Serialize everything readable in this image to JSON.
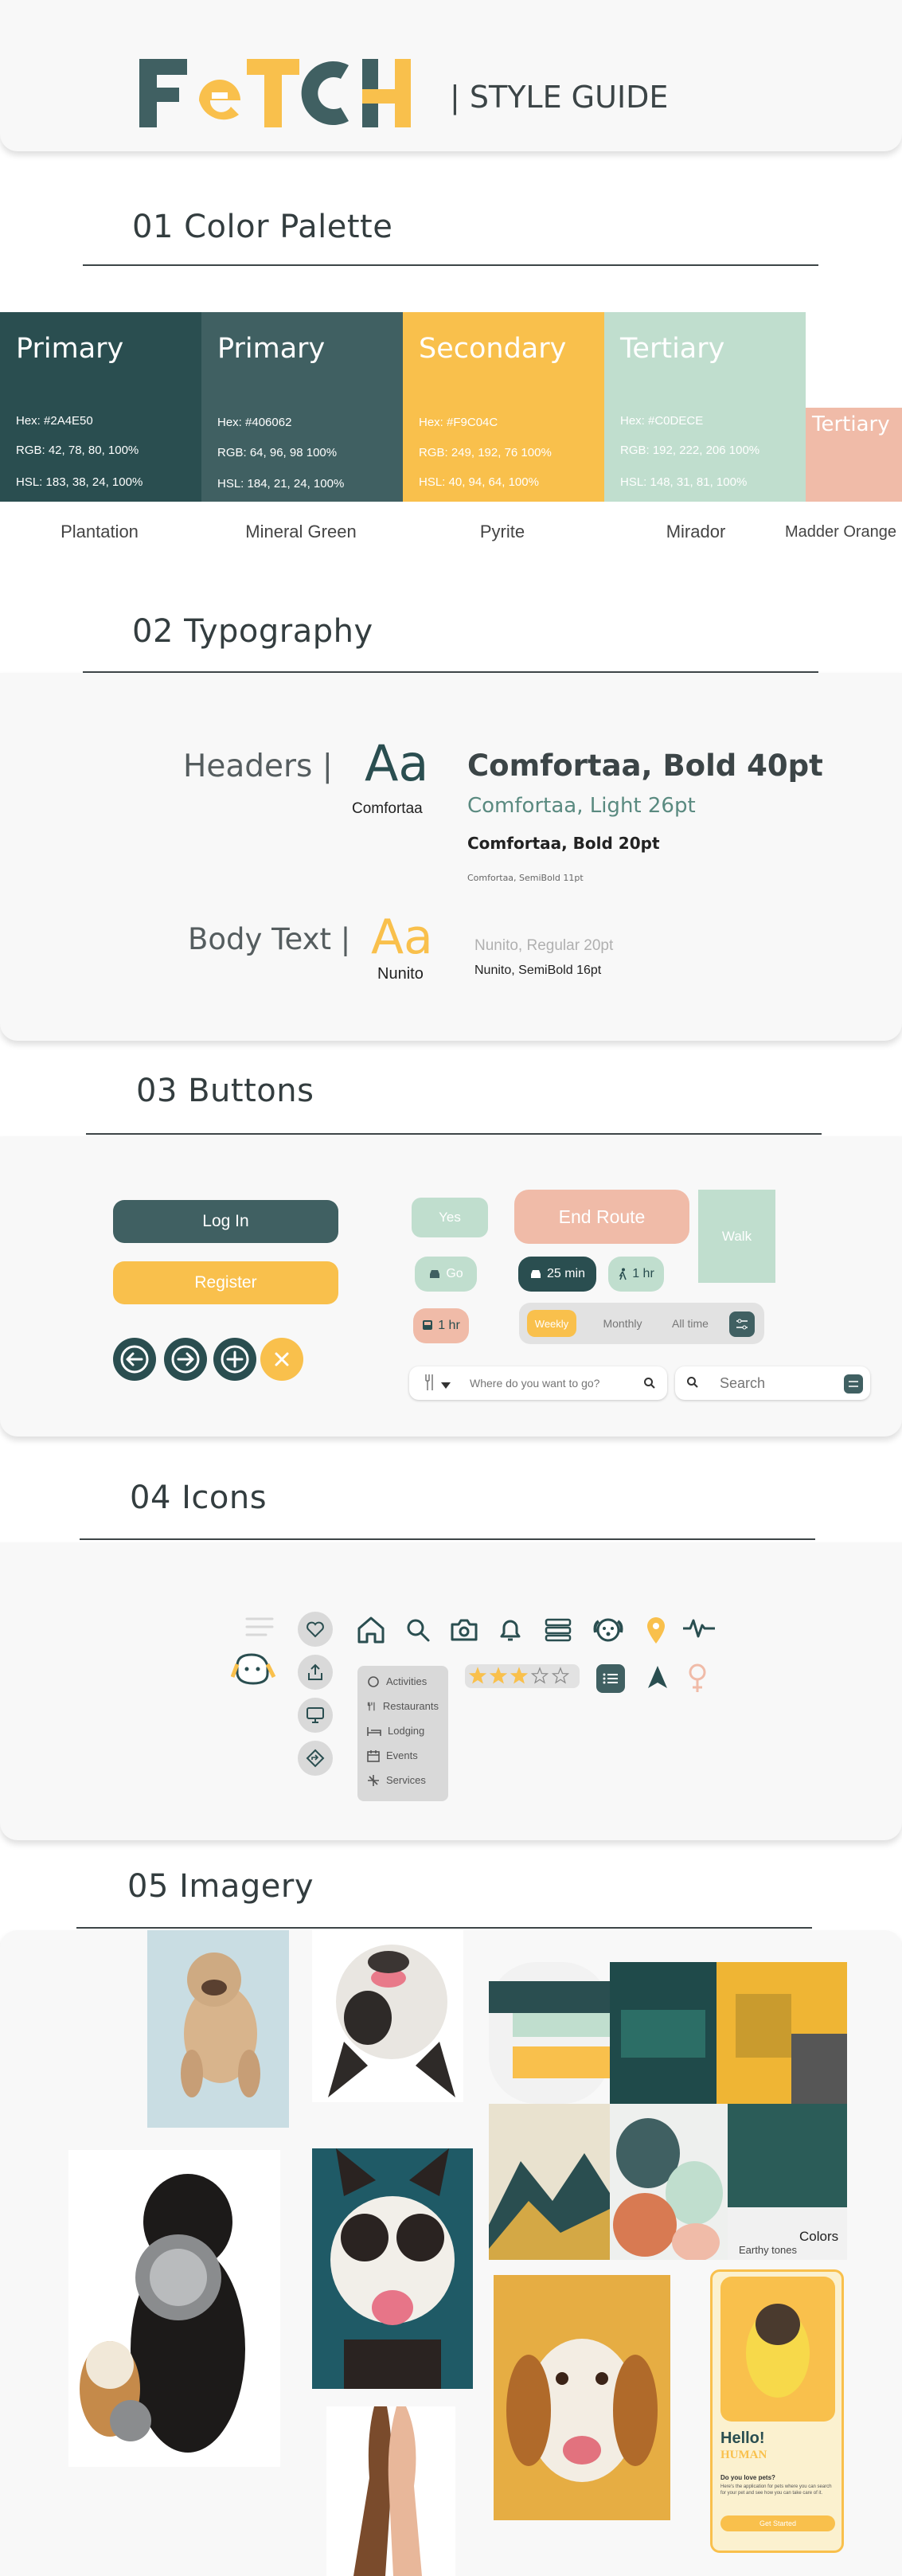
{
  "header": {
    "logo_text": "FETCH",
    "subtitle": "| STYLE GUIDE"
  },
  "sections": {
    "color": "01 Color Palette",
    "typography": "02 Typography",
    "buttons": "03 Buttons",
    "icons": "04 Icons",
    "imagery": "05 Imagery"
  },
  "colors": {
    "plantation": "#2A4E50",
    "mineral_green": "#406062",
    "pyrite": "#F9C04C",
    "mirador": "#C0DECE",
    "madder_orange": "#F0BBA8"
  },
  "palette": [
    {
      "title": "Primary",
      "hex": "Hex: #2A4E50",
      "rgb": "RGB: 42, 78, 80, 100%",
      "hsl": "HSL: 183, 38, 24, 100%",
      "name": "Plantation"
    },
    {
      "title": "Primary",
      "hex": "Hex: #406062",
      "rgb": "RGB: 64, 96, 98 100%",
      "hsl": "HSL: 184, 21, 24, 100%",
      "name": "Mineral Green"
    },
    {
      "title": "Secondary",
      "hex": "Hex: #F9C04C",
      "rgb": "RGB: 249, 192, 76 100%",
      "hsl": "HSL: 40, 94, 64, 100%",
      "name": "Pyrite"
    },
    {
      "title": "Tertiary",
      "hex": "Hex: #C0DECE",
      "rgb": "RGB: 192, 222, 206 100%",
      "hsl": "HSL: 148, 31, 81, 100%",
      "name": "Mirador"
    },
    {
      "title": "Tertiary",
      "name": "Madder Orange"
    }
  ],
  "typography": {
    "headers_label": "Headers |",
    "body_label": "Body Text |",
    "sample_glyphs": "Aa",
    "header_font": "Comfortaa",
    "body_font": "Nunito",
    "h1": "Comfortaa, Bold 40pt",
    "h2": "Comfortaa, Light 26pt",
    "h3": "Comfortaa, Bold 20pt",
    "h4": "Comfortaa, SemiBold 11pt",
    "b1": "Nunito, Regular 20pt",
    "b2": "Nunito, SemiBold 16pt"
  },
  "buttons": {
    "login": "Log In",
    "register": "Register",
    "yes": "Yes",
    "end_route": "End Route",
    "walk": "Walk",
    "go": "Go",
    "min25": "25 min",
    "hr1": "1 hr",
    "hr1b": "1 hr",
    "weekly": "Weekly",
    "monthly": "Monthly",
    "all_time": "All time",
    "search_where_placeholder": "Where do you want to go?",
    "search_placeholder": "Search"
  },
  "icons": {
    "menu": [
      "Activities",
      "Restaurants",
      "Lodging",
      "Events",
      "Services"
    ],
    "rating": 3,
    "rating_max": 5
  },
  "imagery": {
    "moodboard_caption": "Colors",
    "moodboard_sub": "Earthy tones",
    "app_hello": "Hello!",
    "app_human": "HUMAN",
    "app_question": "Do you love pets?",
    "app_body": "Here's the application for pets where you can search for your pet and see how you can take care of it.",
    "app_cta": "Get Started"
  }
}
